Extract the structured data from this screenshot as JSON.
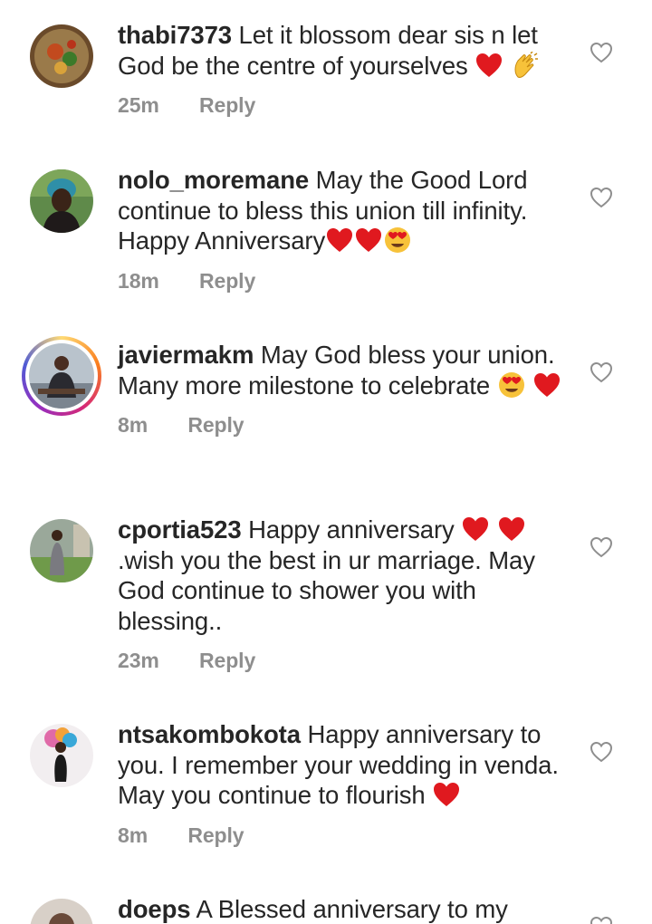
{
  "comments": [
    {
      "username": "thabi7373",
      "text": "Let it blossom dear sis n let God be the centre of yourselves",
      "emojis": [
        "red-heart",
        "clapping-hands"
      ],
      "time": "25m",
      "reply_label": "Reply"
    },
    {
      "username": "nolo_moremane",
      "text": "May the Good Lord continue to bless this union till infinity. Happy Anniversary",
      "emojis": [
        "red-heart",
        "red-heart",
        "heart-eyes"
      ],
      "time": "18m",
      "reply_label": "Reply"
    },
    {
      "username": "javiermakm",
      "text": "May God bless your union. Many more milestone to celebrate",
      "emojis": [
        "heart-eyes",
        "red-heart"
      ],
      "time": "8m",
      "reply_label": "Reply"
    },
    {
      "username": "cportia523",
      "text_a": "Happy  anniversary",
      "text_b": ".wish you  the best in ur marriage. May God continue  to shower you with blessing..",
      "emojis": [
        "red-heart",
        "red-heart"
      ],
      "time": "23m",
      "reply_label": "Reply"
    },
    {
      "username": "ntsakombokota",
      "text": "Happy anniversary to you. I remember your wedding in venda. May you continue to flourish",
      "emojis": [
        "red-heart"
      ],
      "time": "8m",
      "reply_label": "Reply"
    },
    {
      "username": "doeps",
      "text": "A Blessed anniversary to my"
    }
  ],
  "icons": {
    "like": "heart-outline-icon"
  },
  "colors": {
    "text": "#262626",
    "meta": "#8e8e8e",
    "heart": "#e0191f"
  }
}
